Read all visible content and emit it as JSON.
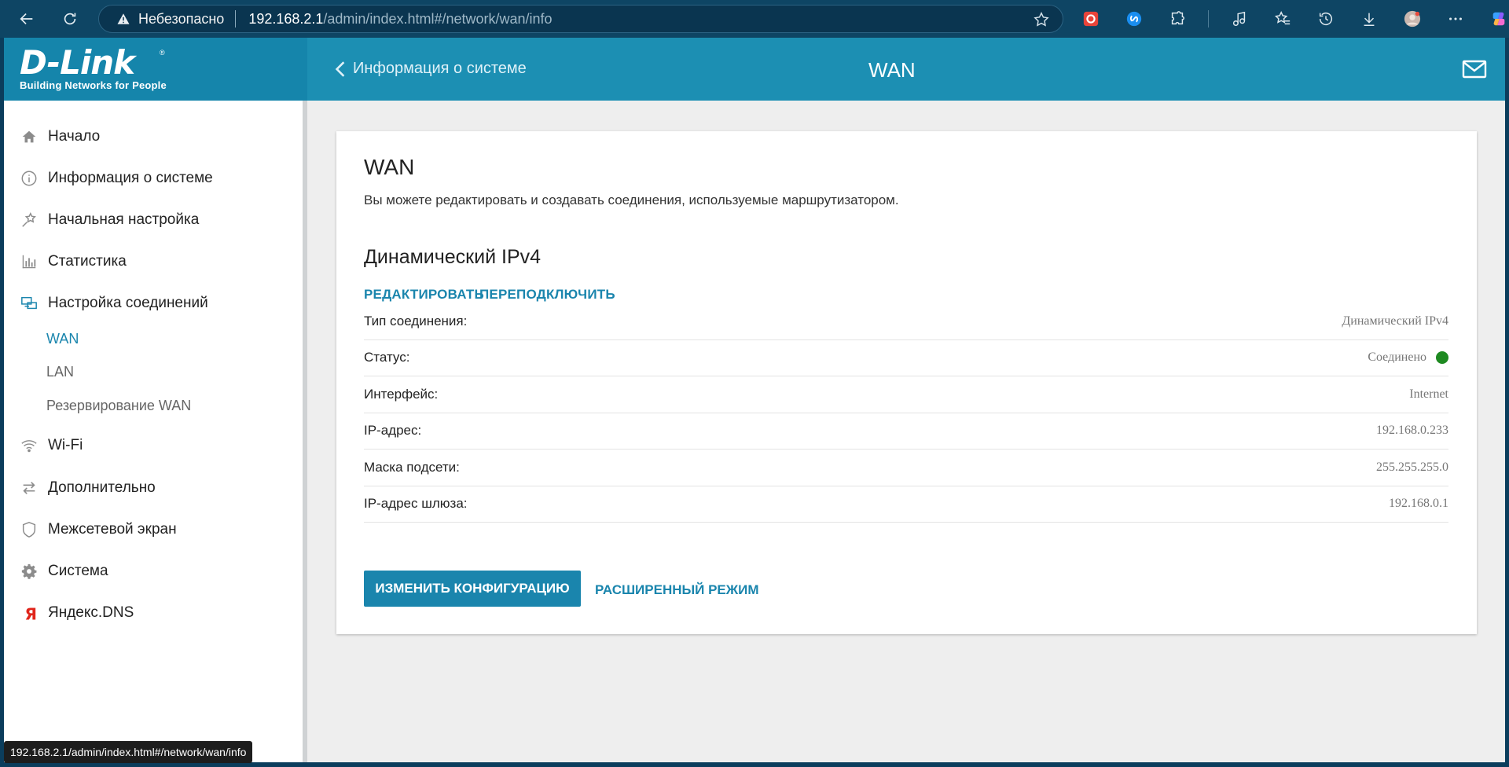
{
  "browser": {
    "insecure_label": "Небезопасно",
    "url_host": "192.168.2.1",
    "url_path": "/admin/index.html#/network/wan/info",
    "status_url": "192.168.2.1/admin/index.html#/network/wan/info"
  },
  "header": {
    "logo_mark": "D-Link",
    "logo_tagline": "Building Networks for People",
    "back_label": "Информация о системе",
    "page_title": "WAN"
  },
  "sidebar": {
    "items": [
      {
        "label": "Начало",
        "icon": "home-icon"
      },
      {
        "label": "Информация о системе",
        "icon": "info-icon"
      },
      {
        "label": "Начальная настройка",
        "icon": "wizard-icon"
      },
      {
        "label": "Статистика",
        "icon": "stats-icon"
      },
      {
        "label": "Настройка соединений",
        "icon": "connections-icon"
      },
      {
        "label": "Wi-Fi",
        "icon": "wifi-icon"
      },
      {
        "label": "Дополнительно",
        "icon": "transfer-icon"
      },
      {
        "label": "Межсетевой экран",
        "icon": "shield-icon"
      },
      {
        "label": "Система",
        "icon": "gear-icon"
      },
      {
        "label": "Яндекс.DNS",
        "icon": "yandex-icon"
      }
    ],
    "sub_items": [
      {
        "label": "WAN",
        "active": true
      },
      {
        "label": "LAN",
        "active": false
      },
      {
        "label": "Резервирование WAN",
        "active": false
      }
    ]
  },
  "main": {
    "title": "WAN",
    "description": "Вы можете редактировать и создавать соединения, используемые маршрутизатором.",
    "connection_title": "Динамический IPv4",
    "edit_label": "РЕДАКТИРОВАТЬ",
    "reconnect_label": "ПЕРЕПОДКЛЮЧИТЬ",
    "info_rows": [
      {
        "label": "Тип соединения:",
        "value": "Динамический IPv4"
      },
      {
        "label": "Статус:",
        "value": "Соединено"
      },
      {
        "label": "Интерфейс:",
        "value": "Internet"
      },
      {
        "label": "IP-адрес:",
        "value": "192.168.0.233"
      },
      {
        "label": "Маска подсети:",
        "value": "255.255.255.0"
      },
      {
        "label": "IP-адрес шлюза:",
        "value": "192.168.0.1"
      }
    ],
    "change_config_label": "ИЗМЕНИТЬ КОНФИГУРАЦИЮ",
    "advanced_mode_label": "РАСШИРЕННЫЙ РЕЖИМ"
  },
  "colors": {
    "accent": "#1a85ad",
    "header": "#1c8fb3",
    "status_ok": "#1e8a21"
  }
}
